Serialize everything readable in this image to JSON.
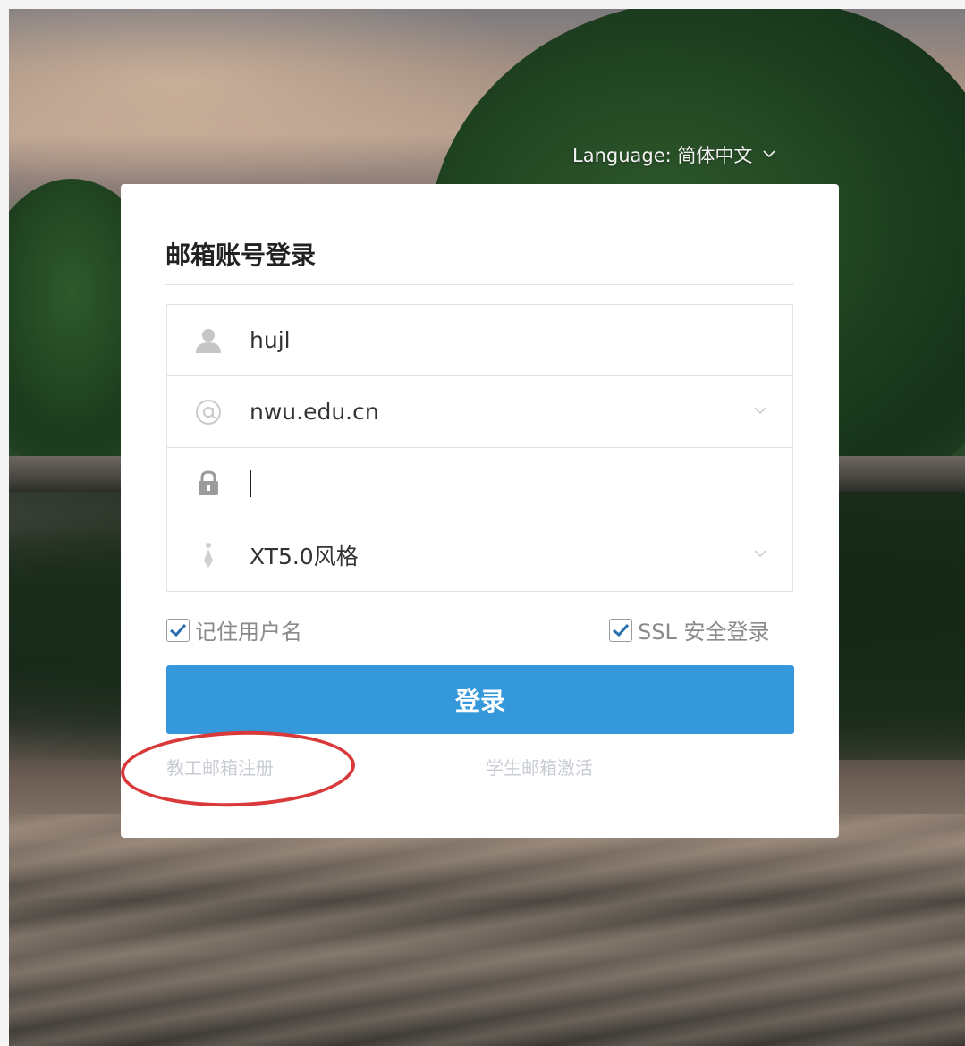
{
  "language": {
    "label": "Language: 简体中文"
  },
  "login": {
    "title": "邮箱账号登录",
    "username_value": "hujl",
    "domain_value": "nwu.edu.cn",
    "password_value": "",
    "style_value": "XT5.0风格",
    "remember_label": "记住用户名",
    "remember_checked": true,
    "ssl_label": "SSL 安全登录",
    "ssl_checked": true,
    "submit_label": "登录"
  },
  "links": {
    "staff_register": "教工邮箱注册",
    "student_activate": "学生邮箱激活"
  },
  "colors": {
    "primary": "#3498db",
    "annotation": "#d9393a"
  },
  "icons": [
    "user-icon",
    "at-icon",
    "lock-icon",
    "tie-icon",
    "chevron-down-icon",
    "check-icon"
  ]
}
